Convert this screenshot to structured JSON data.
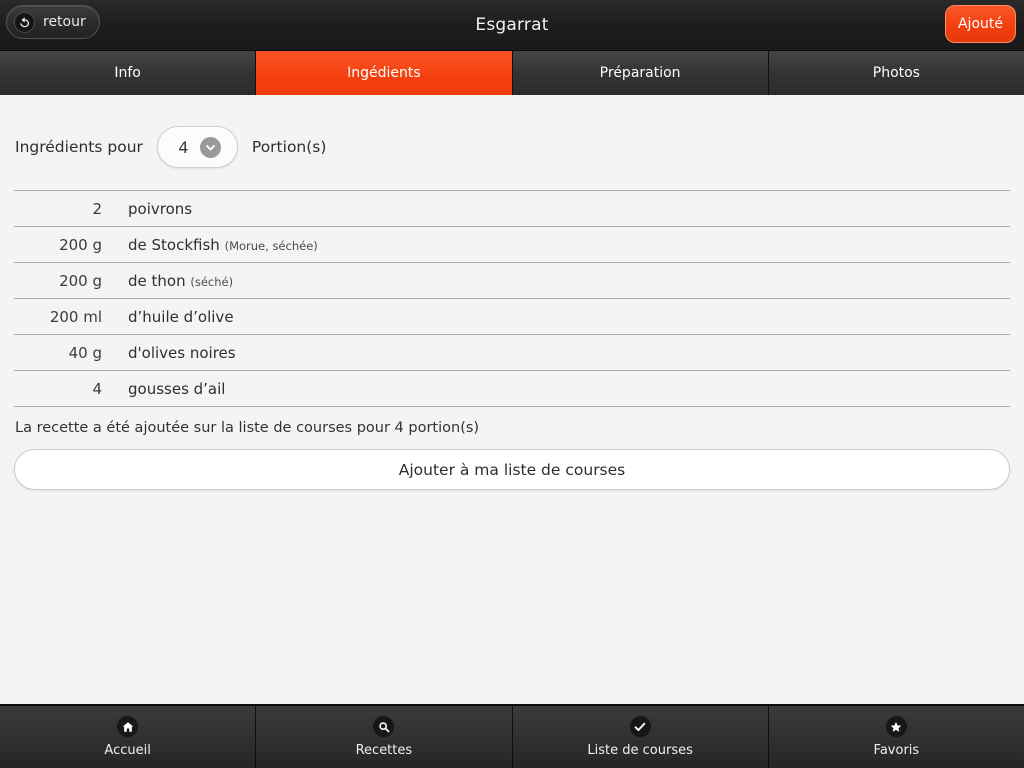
{
  "header": {
    "title": "Esgarrat",
    "back_label": "retour",
    "back_icon": "undo-arrow-icon",
    "added_label": "Ajouté"
  },
  "tabs": [
    {
      "label": "Info",
      "active": false
    },
    {
      "label": "Ingédients",
      "active": true
    },
    {
      "label": "Préparation",
      "active": false
    },
    {
      "label": "Photos",
      "active": false
    }
  ],
  "portions": {
    "prefix_label": "Ingrédients pour",
    "value": "4",
    "suffix_label": "Portion(s)",
    "chevron_icon": "chevron-down-icon"
  },
  "ingredients": [
    {
      "qty": "2",
      "name": "poivrons",
      "note": ""
    },
    {
      "qty": "200 g",
      "name": "de Stockfish",
      "note": "(Morue, séchée)"
    },
    {
      "qty": "200 g",
      "name": "de thon",
      "note": "(séché)"
    },
    {
      "qty": "200 ml",
      "name": "d’huile d’olive",
      "note": ""
    },
    {
      "qty": "40 g",
      "name": "d'olives noires",
      "note": ""
    },
    {
      "qty": "4",
      "name": "gousses d’ail",
      "note": ""
    }
  ],
  "status_message": "La recette a été ajoutée sur la liste de courses pour 4 portion(s)",
  "add_to_list_button": "Ajouter à ma liste de courses",
  "bottom_nav": [
    {
      "label": "Accueil",
      "icon": "home-icon"
    },
    {
      "label": "Recettes",
      "icon": "search-icon"
    },
    {
      "label": "Liste de courses",
      "icon": "check-icon"
    },
    {
      "label": "Favoris",
      "icon": "star-icon"
    }
  ],
  "colors": {
    "accent": "#f4400f",
    "header_bg": "#1d1d1d",
    "content_bg": "#f4f4f4",
    "separator": "#a9a9a9"
  }
}
